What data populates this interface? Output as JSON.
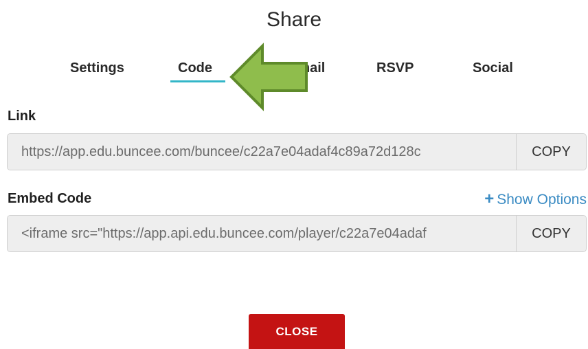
{
  "dialog": {
    "title": "Share"
  },
  "tabs": [
    {
      "label": "Settings"
    },
    {
      "label": "Code",
      "active": true
    },
    {
      "label": "Email"
    },
    {
      "label": "RSVP"
    },
    {
      "label": "Social"
    }
  ],
  "link": {
    "label": "Link",
    "value": "https://app.edu.buncee.com/buncee/c22a7e04adaf4c89a72d128c",
    "copy_label": "COPY"
  },
  "embed": {
    "label": "Embed Code",
    "show_options_label": "Show Options",
    "value": "<iframe src=\"https://app.api.edu.buncee.com/player/c22a7e04adaf",
    "copy_label": "COPY"
  },
  "footer": {
    "close_label": "CLOSE"
  },
  "annotation": {
    "arrow_color": "#8fbd4c",
    "arrow_border": "#5e8a2a"
  },
  "colors": {
    "accent": "#33b6c8",
    "link": "#3a8bc3",
    "close": "#c41313"
  }
}
